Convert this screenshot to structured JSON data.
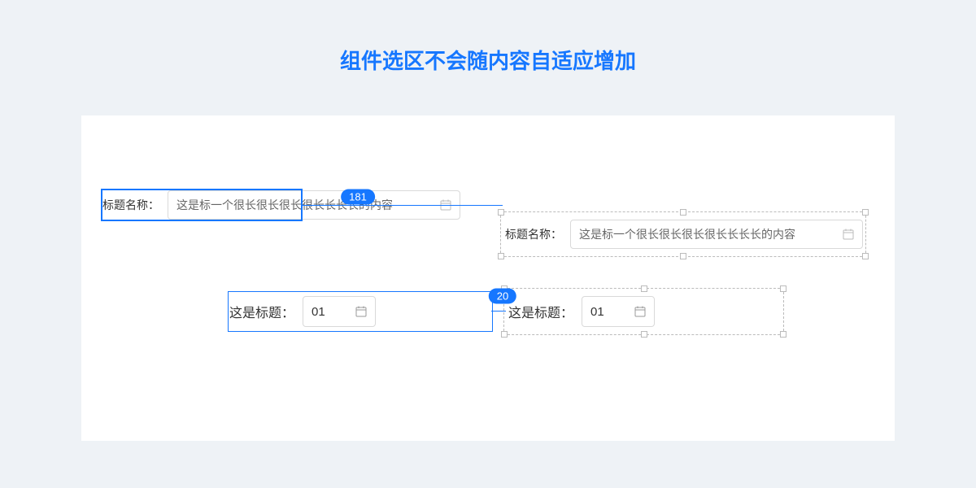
{
  "title": "组件选区不会随内容自适应增加",
  "row1": {
    "left": {
      "label": "标题名称：",
      "value": "这是标一个很长很长很长很长长长长的内容"
    },
    "right": {
      "label": "标题名称：",
      "value": "这是标一个很长很长很长很长长长长的内容"
    },
    "measure": "181"
  },
  "row2": {
    "left": {
      "label": "这是标题：",
      "value": "01"
    },
    "right": {
      "label": "这是标题：",
      "value": "01"
    },
    "measure": "20"
  }
}
